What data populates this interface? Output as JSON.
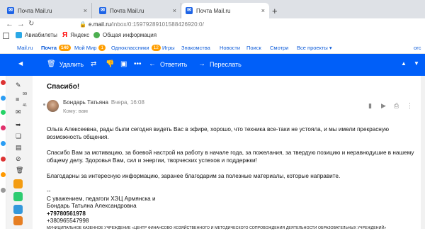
{
  "tabs": [
    {
      "title": "Почта Mail.ru",
      "close": "×"
    },
    {
      "title": "Почта Mail.ru",
      "close": "×"
    },
    {
      "title": "Почта Mail.ru",
      "close": "×"
    }
  ],
  "new_tab": "+",
  "address_bar": {
    "url_host": "e.mail.ru",
    "url_path": "/inbox/0:15979289101588426920:0/"
  },
  "bookmarks": [
    {
      "label": "Авиабилеты"
    },
    {
      "label": "Яндекс"
    },
    {
      "label": "Общая информация"
    }
  ],
  "portal_nav": {
    "items": [
      {
        "label": "Mail.ru"
      },
      {
        "label": "Почта",
        "badge": "140"
      },
      {
        "label": "Мой Мир",
        "badge": "1"
      },
      {
        "label": "Одноклассники",
        "badge": "12"
      },
      {
        "label": "Игры"
      },
      {
        "label": "Знакомства"
      },
      {
        "label": "Новости"
      },
      {
        "label": "Поиск"
      },
      {
        "label": "Смотри"
      },
      {
        "label": "Все проекты ▾"
      }
    ],
    "right_label": "огс"
  },
  "toolbar": {
    "delete_label": "Удалить",
    "reply_label": "Ответить",
    "forward_label": "Переслать"
  },
  "sidebar": {
    "counts": [
      "99",
      "41"
    ]
  },
  "email": {
    "subject": "Спасибо!",
    "sender": "Бондарь Татьяна",
    "date": "Вчера, 16:08",
    "to": "Кому: вам",
    "paragraphs": [
      "Ольга Алексеевна, рады были сегодня видеть Вас в эфире, хорошо, что техника все-таки не устояла, и мы имели прекрасную возможность общения.",
      "Спасибо Вам за мотивацию, за боевой настрой на работу в начале года, за пожелания, за твердую позицию и неравнодушие в нашему общему делу. Здоровья Вам, сил и энергии, творческих успехов и поддержки!",
      "Благодарны за интересную информацию, заранее благодарим за полезные материалы, которые направите."
    ],
    "signature": {
      "dashes": "--",
      "line1": "С уважением, педагоги ХЭЦ Армянска и",
      "line2": "Бондарь Татьяна Александровна",
      "phone1": "+79780561978",
      "phone2": "+380965547998",
      "org": "МУНИЦИПАЛЬНОЕ КАЗЕННОЕ УЧРЕЖДЕНИЕ «ЦЕНТР ФИНАНСОВО-ХОЗЯЙСТВЕННОГО И МЕТОДИЧЕСКОГО СОПРОВОЖДЕНИЯ ДЕЯТЕЛЬНОСТИ ОБРАЗОВАТЕЛЬНЫХ УЧРЕЖДЕНИЙ»"
    }
  },
  "colors": {
    "toolbar_blue": "#005ff9",
    "badge_orange": "#ff9e00",
    "badge_blue": "#005ff9"
  }
}
